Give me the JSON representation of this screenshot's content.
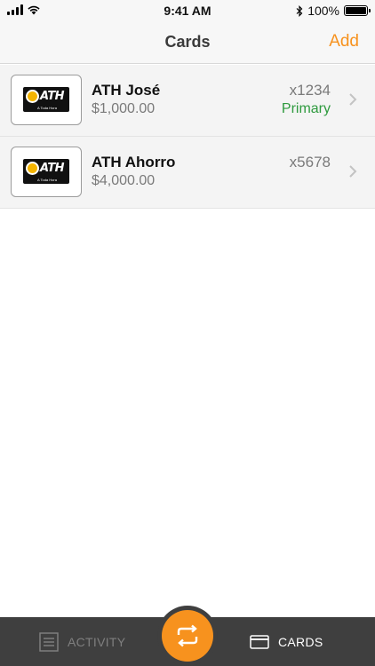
{
  "status_bar": {
    "time": "9:41 AM",
    "battery": "100%",
    "battery_level": 1.0
  },
  "nav": {
    "title": "Cards",
    "add_label": "Add"
  },
  "cards": [
    {
      "name": "ATH José",
      "amount": "$1,000.00",
      "number": "x1234",
      "badge": "Primary",
      "logo_text": "ATH",
      "logo_sub": "A Toda Hora"
    },
    {
      "name": "ATH Ahorro",
      "amount": "$4,000.00",
      "number": "x5678",
      "badge": "",
      "logo_text": "ATH",
      "logo_sub": "A Toda Hora"
    }
  ],
  "tab_bar": {
    "activity_label": "ACTIVITY",
    "cards_label": "CARDS",
    "icons": {
      "activity": "list-icon",
      "transfer": "transfer-arrows-icon",
      "cards": "credit-card-icon"
    }
  },
  "colors": {
    "accent": "#f7921e",
    "primary_badge": "#2e9a3e",
    "tab_bar_bg": "#3f3f3f"
  }
}
